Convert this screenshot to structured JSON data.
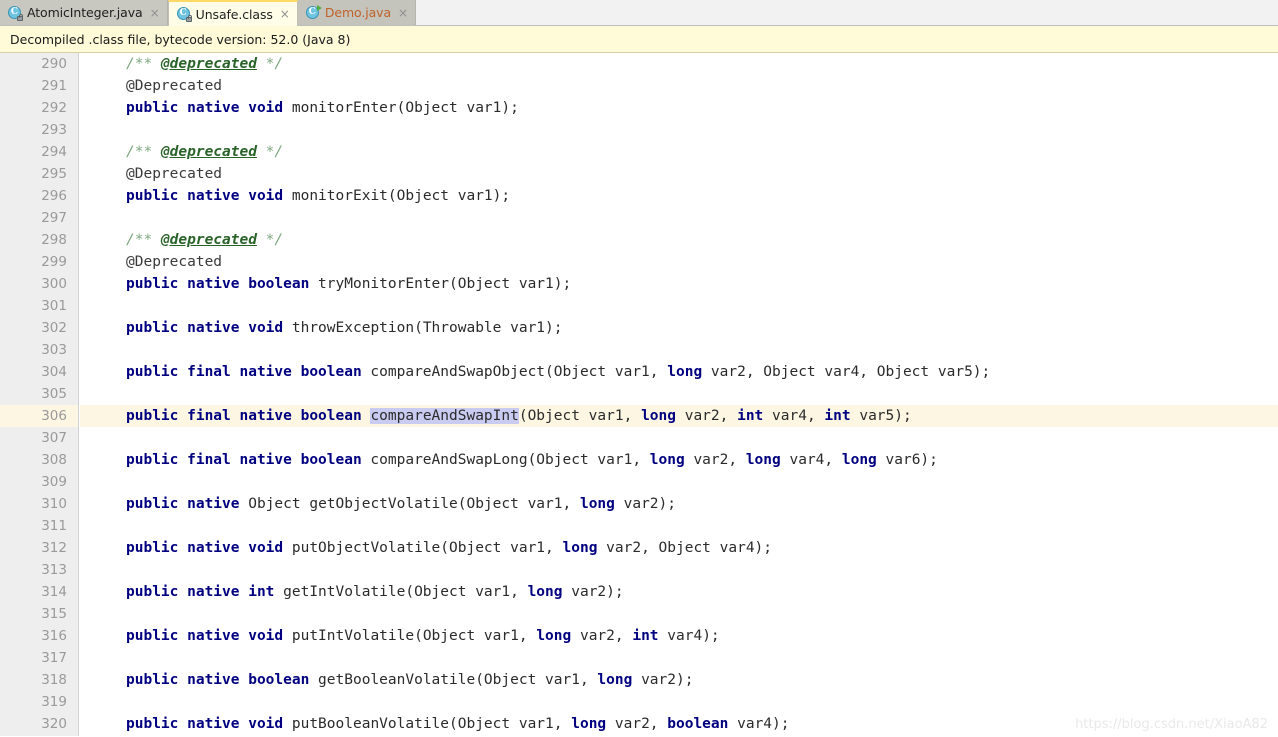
{
  "tabs": [
    {
      "label": "AtomicInteger.java",
      "icon": "java-class-locked-icon",
      "state": "inactive",
      "close": "×",
      "letter": "C"
    },
    {
      "label": "Unsafe.class",
      "icon": "java-class-locked-icon",
      "state": "active",
      "close": "×",
      "letter": "C"
    },
    {
      "label": "Demo.java",
      "icon": "java-runnable-icon",
      "state": "inactive",
      "close": "×",
      "letter": "C"
    }
  ],
  "notification": {
    "text": "Decompiled .class file, bytecode version: 52.0 (Java 8)"
  },
  "editor": {
    "first_line_number": 290,
    "highlighted_line_number": 306,
    "selection_text": "compareAndSwapInt",
    "lines": [
      {
        "n": 290,
        "tokens": [
          {
            "t": "cmt",
            "v": "/** "
          },
          {
            "t": "tag",
            "v": "@deprecated"
          },
          {
            "t": "cmt",
            "v": " */"
          }
        ]
      },
      {
        "n": 291,
        "tokens": [
          {
            "t": "ann",
            "v": "@Deprecated"
          }
        ]
      },
      {
        "n": 292,
        "tokens": [
          {
            "t": "kw",
            "v": "public native void"
          },
          {
            "t": "plain",
            "v": " monitorEnter(Object var1);"
          }
        ]
      },
      {
        "n": 293,
        "tokens": []
      },
      {
        "n": 294,
        "tokens": [
          {
            "t": "cmt",
            "v": "/** "
          },
          {
            "t": "tag",
            "v": "@deprecated"
          },
          {
            "t": "cmt",
            "v": " */"
          }
        ]
      },
      {
        "n": 295,
        "tokens": [
          {
            "t": "ann",
            "v": "@Deprecated"
          }
        ]
      },
      {
        "n": 296,
        "tokens": [
          {
            "t": "kw",
            "v": "public native void"
          },
          {
            "t": "plain",
            "v": " monitorExit(Object var1);"
          }
        ]
      },
      {
        "n": 297,
        "tokens": []
      },
      {
        "n": 298,
        "tokens": [
          {
            "t": "cmt",
            "v": "/** "
          },
          {
            "t": "tag",
            "v": "@deprecated"
          },
          {
            "t": "cmt",
            "v": " */"
          }
        ]
      },
      {
        "n": 299,
        "tokens": [
          {
            "t": "ann",
            "v": "@Deprecated"
          }
        ]
      },
      {
        "n": 300,
        "tokens": [
          {
            "t": "kw",
            "v": "public native boolean"
          },
          {
            "t": "plain",
            "v": " tryMonitorEnter(Object var1);"
          }
        ]
      },
      {
        "n": 301,
        "tokens": []
      },
      {
        "n": 302,
        "tokens": [
          {
            "t": "kw",
            "v": "public native void"
          },
          {
            "t": "plain",
            "v": " throwException(Throwable var1);"
          }
        ]
      },
      {
        "n": 303,
        "tokens": []
      },
      {
        "n": 304,
        "tokens": [
          {
            "t": "kw",
            "v": "public final native boolean"
          },
          {
            "t": "plain",
            "v": " compareAndSwapObject(Object var1, "
          },
          {
            "t": "kw",
            "v": "long"
          },
          {
            "t": "plain",
            "v": " var2, Object var4, Object var5);"
          }
        ]
      },
      {
        "n": 305,
        "tokens": []
      },
      {
        "n": 306,
        "hl": true,
        "tokens": [
          {
            "t": "kw",
            "v": "public final native boolean"
          },
          {
            "t": "plain",
            "v": " "
          },
          {
            "t": "sel",
            "v": "compareAndSwapInt"
          },
          {
            "t": "plain",
            "v": "(Object var1, "
          },
          {
            "t": "kw",
            "v": "long"
          },
          {
            "t": "plain",
            "v": " var2, "
          },
          {
            "t": "kw",
            "v": "int"
          },
          {
            "t": "plain",
            "v": " var4, "
          },
          {
            "t": "kw",
            "v": "int"
          },
          {
            "t": "plain",
            "v": " var5);"
          }
        ]
      },
      {
        "n": 307,
        "tokens": []
      },
      {
        "n": 308,
        "tokens": [
          {
            "t": "kw",
            "v": "public final native boolean"
          },
          {
            "t": "plain",
            "v": " compareAndSwapLong(Object var1, "
          },
          {
            "t": "kw",
            "v": "long"
          },
          {
            "t": "plain",
            "v": " var2, "
          },
          {
            "t": "kw",
            "v": "long"
          },
          {
            "t": "plain",
            "v": " var4, "
          },
          {
            "t": "kw",
            "v": "long"
          },
          {
            "t": "plain",
            "v": " var6);"
          }
        ]
      },
      {
        "n": 309,
        "tokens": []
      },
      {
        "n": 310,
        "tokens": [
          {
            "t": "kw",
            "v": "public native"
          },
          {
            "t": "plain",
            "v": " Object getObjectVolatile(Object var1, "
          },
          {
            "t": "kw",
            "v": "long"
          },
          {
            "t": "plain",
            "v": " var2);"
          }
        ]
      },
      {
        "n": 311,
        "tokens": []
      },
      {
        "n": 312,
        "tokens": [
          {
            "t": "kw",
            "v": "public native void"
          },
          {
            "t": "plain",
            "v": " putObjectVolatile(Object var1, "
          },
          {
            "t": "kw",
            "v": "long"
          },
          {
            "t": "plain",
            "v": " var2, Object var4);"
          }
        ]
      },
      {
        "n": 313,
        "tokens": []
      },
      {
        "n": 314,
        "tokens": [
          {
            "t": "kw",
            "v": "public native int"
          },
          {
            "t": "plain",
            "v": " getIntVolatile(Object var1, "
          },
          {
            "t": "kw",
            "v": "long"
          },
          {
            "t": "plain",
            "v": " var2);"
          }
        ]
      },
      {
        "n": 315,
        "tokens": []
      },
      {
        "n": 316,
        "tokens": [
          {
            "t": "kw",
            "v": "public native void"
          },
          {
            "t": "plain",
            "v": " putIntVolatile(Object var1, "
          },
          {
            "t": "kw",
            "v": "long"
          },
          {
            "t": "plain",
            "v": " var2, "
          },
          {
            "t": "kw",
            "v": "int"
          },
          {
            "t": "plain",
            "v": " var4);"
          }
        ]
      },
      {
        "n": 317,
        "tokens": []
      },
      {
        "n": 318,
        "tokens": [
          {
            "t": "kw",
            "v": "public native boolean"
          },
          {
            "t": "plain",
            "v": " getBooleanVolatile(Object var1, "
          },
          {
            "t": "kw",
            "v": "long"
          },
          {
            "t": "plain",
            "v": " var2);"
          }
        ]
      },
      {
        "n": 319,
        "tokens": []
      },
      {
        "n": 320,
        "tokens": [
          {
            "t": "kw",
            "v": "public native void"
          },
          {
            "t": "plain",
            "v": " putBooleanVolatile(Object var1, "
          },
          {
            "t": "kw",
            "v": "long"
          },
          {
            "t": "plain",
            "v": " var2, "
          },
          {
            "t": "kw",
            "v": "boolean"
          },
          {
            "t": "plain",
            "v": " var4);"
          }
        ]
      }
    ]
  },
  "watermark": {
    "text": "https://blog.csdn.net/XiaoA82"
  },
  "colors": {
    "keyword": "#000080",
    "comment": "#7ea77e",
    "javadoc_tag": "#2a632a",
    "selection": "#c9cbf0",
    "highlight_line": "#fdf6e3",
    "notification_bg": "#fffbd9",
    "active_tab_bg": "#fffde8",
    "active_tab_border": "#ffd966",
    "run_tab_text": "#c0622a"
  }
}
